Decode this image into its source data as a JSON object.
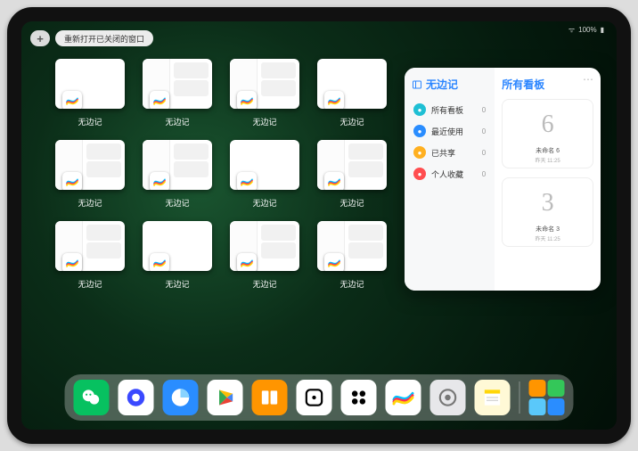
{
  "status": {
    "wifi": "􀙇",
    "battery": "100%"
  },
  "topbar": {
    "plus": "+",
    "reopen_label": "重新打开已关闭的窗口"
  },
  "windows": {
    "app_label": "无边记",
    "items": [
      {
        "variant": "simple"
      },
      {
        "variant": "content"
      },
      {
        "variant": "content"
      },
      {
        "variant": "simple"
      },
      {
        "variant": "content"
      },
      {
        "variant": "content"
      },
      {
        "variant": "simple"
      },
      {
        "variant": "content"
      },
      {
        "variant": "content"
      },
      {
        "variant": "simple"
      },
      {
        "variant": "content"
      },
      {
        "variant": "content"
      }
    ]
  },
  "side_app": {
    "title": "无边记",
    "nav": [
      {
        "icon_name": "grid-icon",
        "color": "#1fbfd4",
        "label": "所有看板",
        "count": 0
      },
      {
        "icon_name": "clock-icon",
        "color": "#2a8dff",
        "label": "最近使用",
        "count": 0
      },
      {
        "icon_name": "share-icon",
        "color": "#ffb020",
        "label": "已共享",
        "count": 0
      },
      {
        "icon_name": "heart-icon",
        "color": "#ff4d4f",
        "label": "个人收藏",
        "count": 0
      }
    ],
    "right_title": "所有看板",
    "boards": [
      {
        "doodle": "6",
        "label": "未命名 6",
        "sub": "昨天 11:25"
      },
      {
        "doodle": "3",
        "label": "未命名 3",
        "sub": "昨天 11:25"
      }
    ]
  },
  "dock": {
    "apps": [
      {
        "name": "wechat",
        "bg": "#07c160"
      },
      {
        "name": "quark",
        "bg": "#ffffff"
      },
      {
        "name": "qqbrowser",
        "bg": "#2a8dff"
      },
      {
        "name": "play",
        "bg": "#ffffff"
      },
      {
        "name": "books",
        "bg": "#ff9500"
      },
      {
        "name": "dice",
        "bg": "#ffffff"
      },
      {
        "name": "game-b",
        "bg": "#ffffff"
      },
      {
        "name": "freeform",
        "bg": "#ffffff"
      },
      {
        "name": "settings",
        "bg": "#e7e7ea"
      },
      {
        "name": "notes",
        "bg": "#fff9d6"
      }
    ]
  }
}
